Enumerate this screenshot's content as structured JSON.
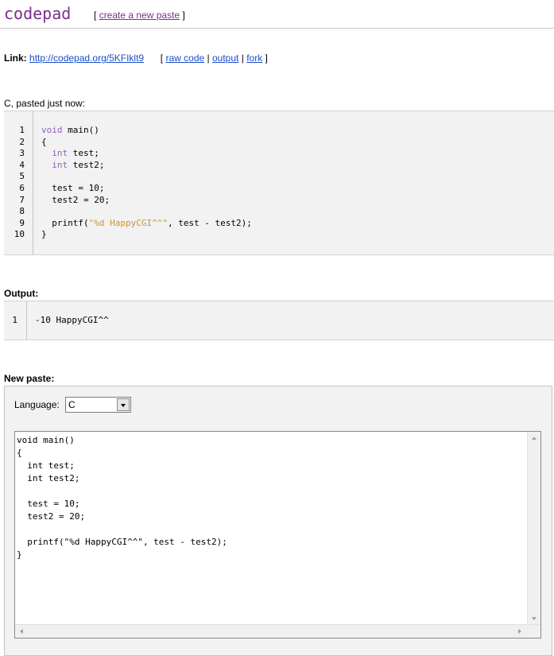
{
  "header": {
    "logo": "codepad",
    "open_bracket": "[",
    "create_link": "create a new paste",
    "close_bracket": "]"
  },
  "linkline": {
    "label": "Link:",
    "url": "http://codepad.org/5KFIklt9",
    "open_bracket": "[",
    "raw_code": "raw code",
    "sep1": "|",
    "output": "output",
    "sep2": "|",
    "fork": "fork",
    "close_bracket": "]"
  },
  "paste_info": {
    "language": "C",
    "suffix": ", pasted just now:"
  },
  "code": {
    "line_numbers": [
      "1",
      "2",
      "3",
      "4",
      "5",
      "6",
      "7",
      "8",
      "9",
      "10"
    ],
    "kw_void": "void",
    "l1_rest": " main()",
    "l2": "{",
    "l3_indent": "  ",
    "kw_int": "int",
    "l3_rest": " test;",
    "l4_rest": " test2;",
    "l5": "",
    "l6": "  test = 10;",
    "l7": "  test2 = 20;",
    "l8": "",
    "l9_pre": "  printf(",
    "l9_str": "\"%d HappyCGI^^\"",
    "l9_post": ", test - test2);",
    "l10": "}"
  },
  "output": {
    "label": "Output:",
    "line_numbers": [
      "1"
    ],
    "lines": [
      "-10 HappyCGI^^"
    ]
  },
  "new_paste": {
    "label": "New paste:",
    "language_label": "Language:",
    "language_value": "C",
    "editor_text": "void main()\n{\n  int test;\n  int test2;\n\n  test = 10;\n  test2 = 20;\n\n  printf(\"%d HappyCGI^^\", test - test2);\n}"
  }
}
